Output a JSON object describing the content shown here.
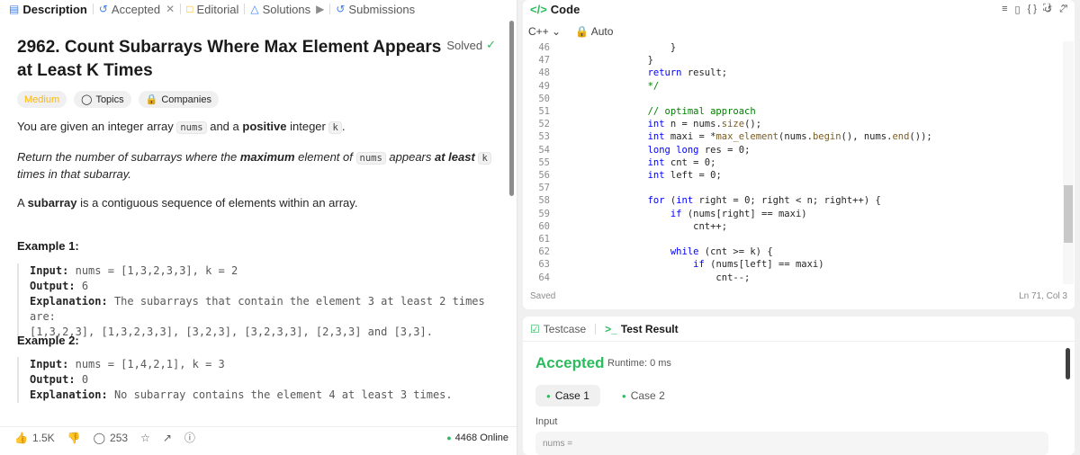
{
  "tabs": [
    {
      "label": "Description",
      "icon": "document-icon"
    },
    {
      "label": "Accepted",
      "icon": "history-icon"
    },
    {
      "label": "Editorial",
      "icon": "book-icon"
    },
    {
      "label": "Solutions",
      "icon": "flask-icon"
    },
    {
      "label": "Submissions",
      "icon": "history-icon"
    }
  ],
  "problem": {
    "title": "2962. Count Subarrays Where Max Element Appears at Least K Times",
    "solved_label": "Solved",
    "difficulty": "Medium",
    "topics_label": "Topics",
    "companies_label": "Companies"
  },
  "desc": {
    "p1_a": "You are given an integer array ",
    "p1_code1": "nums",
    "p1_b": " and a ",
    "p1_bold": "positive",
    "p1_c": " integer ",
    "p1_code2": "k",
    "p1_d": ".",
    "p2_a": "Return the number of subarrays where the ",
    "p2_bold1": "maximum",
    "p2_b": " element of ",
    "p2_code1": "nums",
    "p2_c": " appears ",
    "p2_bold2": "at least",
    "p2_code2": "k",
    "p2_d": " times in that subarray.",
    "p3_a": "A ",
    "p3_bold": "subarray",
    "p3_b": " is a contiguous sequence of elements within an array."
  },
  "examples": [
    {
      "title": "Example 1:",
      "input_label": "Input:",
      "input_value": "nums = [1,3,2,3,3], k = 2",
      "output_label": "Output:",
      "output_value": "6",
      "explanation_label": "Explanation:",
      "explanation_line1": "The subarrays that contain the element 3 at least 2 times are:",
      "explanation_line2": "[1,3,2,3], [1,3,2,3,3], [3,2,3], [3,2,3,3], [2,3,3] and [3,3]."
    },
    {
      "title": "Example 2:",
      "input_label": "Input:",
      "input_value": "nums = [1,4,2,1], k = 3",
      "output_label": "Output:",
      "output_value": "0",
      "explanation_label": "Explanation:",
      "explanation_line1": "No subarray contains the element 4 at least 3 times."
    }
  ],
  "footer": {
    "likes": "1.5K",
    "comments": "253",
    "online": "4468 Online"
  },
  "code": {
    "panel_title": "Code",
    "language": "C++",
    "mode": "Auto",
    "saved_label": "Saved",
    "cursor": "Ln 71, Col 3",
    "lines": [
      {
        "n": "46",
        "text": "            }"
      },
      {
        "n": "47",
        "text": "        }"
      },
      {
        "n": "48",
        "text": "        return result;"
      },
      {
        "n": "49",
        "text": "        */"
      },
      {
        "n": "50",
        "text": ""
      },
      {
        "n": "51",
        "text": "        // optimal approach"
      },
      {
        "n": "52",
        "text": "        int n = nums.size();"
      },
      {
        "n": "53",
        "text": "        int maxi = *max_element(nums.begin(), nums.end());"
      },
      {
        "n": "54",
        "text": "        long long res = 0;"
      },
      {
        "n": "55",
        "text": "        int cnt = 0;"
      },
      {
        "n": "56",
        "text": "        int left = 0;"
      },
      {
        "n": "57",
        "text": ""
      },
      {
        "n": "58",
        "text": "        for (int right = 0; right < n; right++) {"
      },
      {
        "n": "59",
        "text": "            if (nums[right] == maxi)"
      },
      {
        "n": "60",
        "text": "                cnt++;"
      },
      {
        "n": "61",
        "text": ""
      },
      {
        "n": "62",
        "text": "            while (cnt >= k) {"
      },
      {
        "n": "63",
        "text": "                if (nums[left] == maxi)"
      },
      {
        "n": "64",
        "text": "                    cnt--;"
      }
    ]
  },
  "test": {
    "testcase_label": "Testcase",
    "result_label": "Test Result",
    "status": "Accepted",
    "runtime": "Runtime: 0 ms",
    "cases": [
      "Case 1",
      "Case 2"
    ],
    "input_label": "Input",
    "input_preview": "nums ="
  },
  "colors": {
    "accent_green": "#2cbb5d",
    "medium": "#ffb700"
  }
}
